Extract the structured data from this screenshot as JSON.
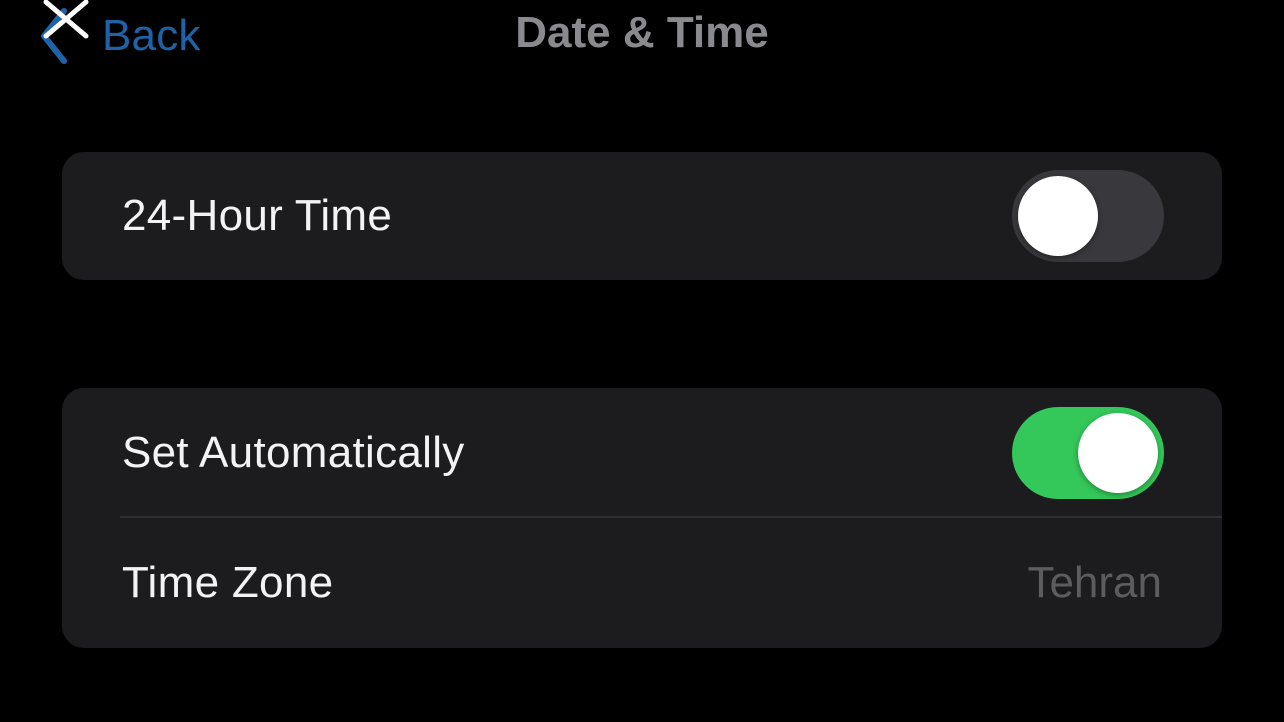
{
  "nav": {
    "back_label": "Back",
    "title": "Date & Time"
  },
  "group_1": {
    "hour24": {
      "label": "24-Hour Time",
      "enabled": false
    }
  },
  "group_2": {
    "set_automatically": {
      "label": "Set Automatically",
      "enabled": true
    },
    "time_zone": {
      "label": "Time Zone",
      "value": "Tehran"
    }
  },
  "colors": {
    "background": "#000000",
    "group_background": "#1c1c1e",
    "toggle_on": "#34c759",
    "toggle_off": "#39393d",
    "link_blue": "#1e63a8",
    "secondary_text": "#5b5b60"
  }
}
